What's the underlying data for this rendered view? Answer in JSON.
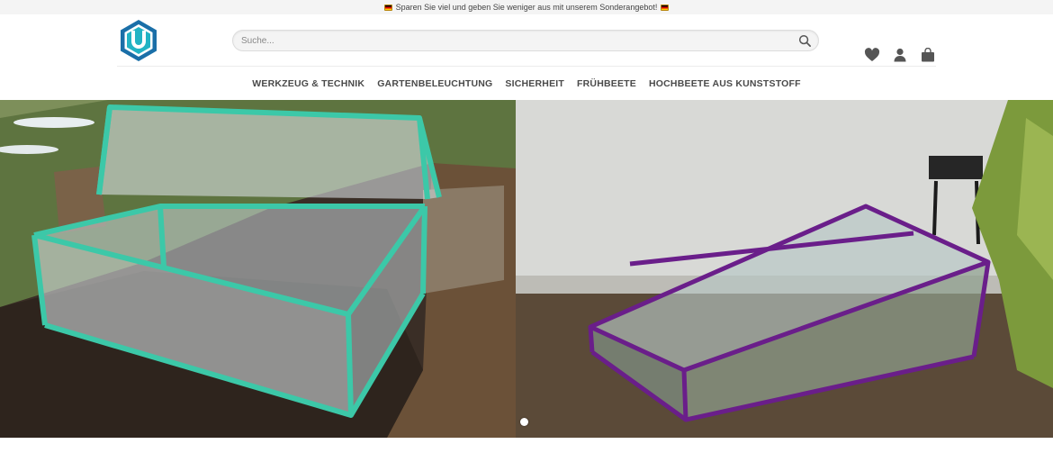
{
  "topbar": {
    "promo_text": "Sparen Sie viel und geben Sie weniger aus mit unserem Sonderangebot!"
  },
  "header": {
    "logo_icon": "hexagon-shield-logo",
    "search": {
      "placeholder": "Suche...",
      "value": ""
    },
    "icons": [
      "heart-icon",
      "user-icon",
      "shopping-bag-icon"
    ]
  },
  "nav": {
    "items": [
      {
        "label": "WERKZEUG & TECHNIK"
      },
      {
        "label": "GARTENBELEUCHTUNG"
      },
      {
        "label": "SICHERHEIT"
      },
      {
        "label": "FRÜHBEETE"
      },
      {
        "label": "HOCHBEETE AUS KUNSTSTOFF"
      }
    ]
  },
  "hero": {
    "slides": [
      {
        "image": "turquoise-cold-frame-photo",
        "frame_color": "#3cc8a8"
      },
      {
        "image": "purple-cold-frame-photo",
        "frame_color": "#6a1e8a"
      }
    ],
    "active_slide_index": 0
  },
  "colors": {
    "brand": "#1a8fb3",
    "accent": "#1cb5a8",
    "nav_text": "#4a4a4a",
    "icon": "#555555"
  }
}
